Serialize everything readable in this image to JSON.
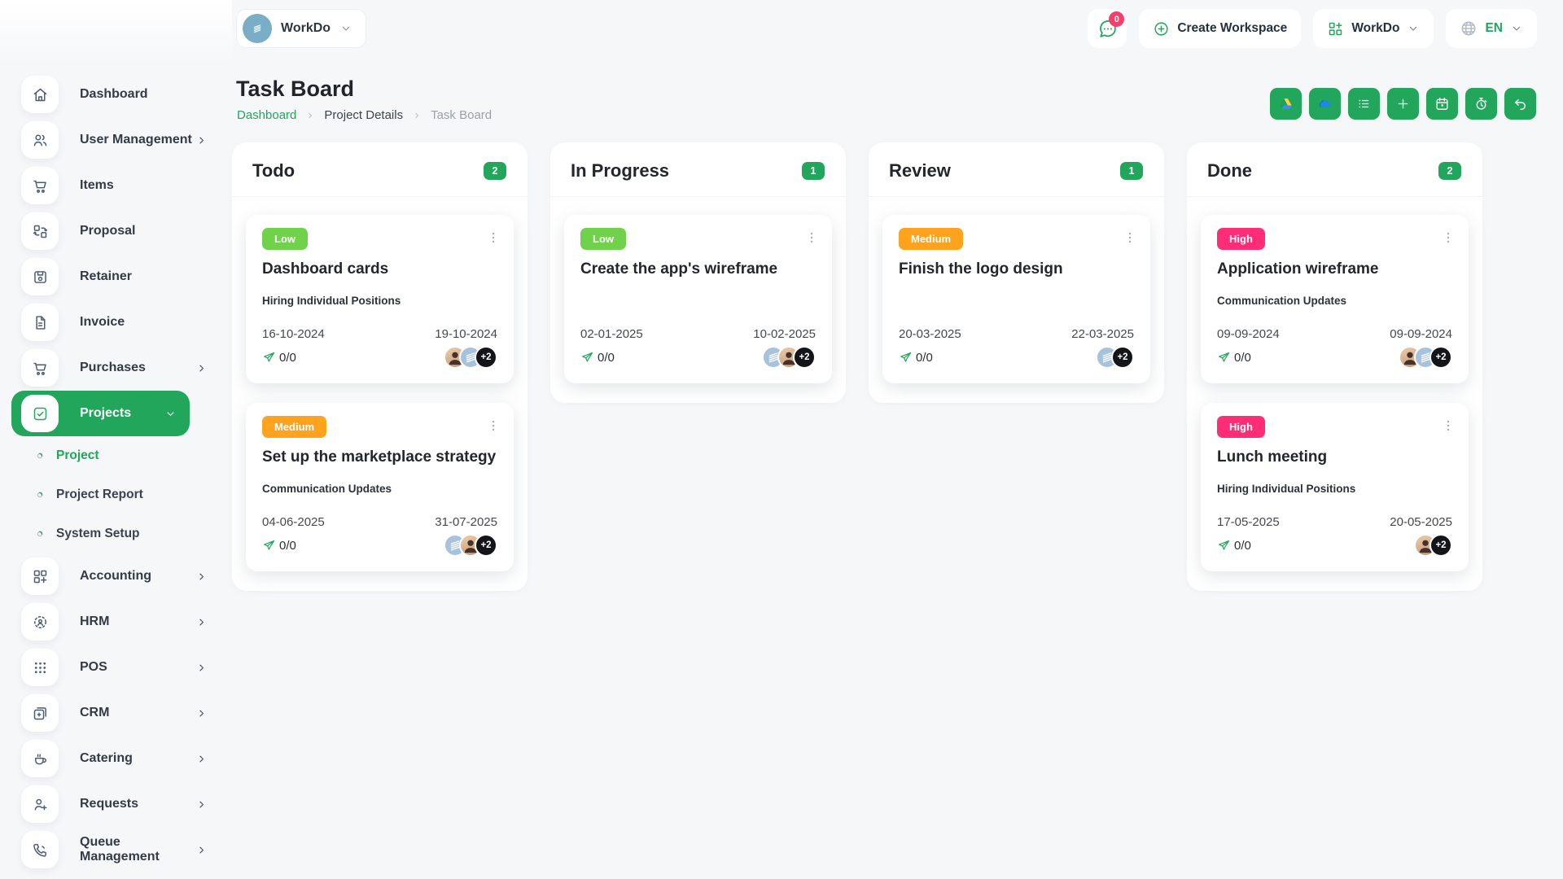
{
  "colors": {
    "primary": "#21a65b",
    "low": "#70d24b",
    "medium": "#ffa21d",
    "high": "#ff2d76",
    "notification": "#f73d6a"
  },
  "topbar": {
    "workspace": {
      "label": "WorkDo",
      "icon": "building-icon"
    },
    "messages": {
      "badge": "0",
      "icon": "chat-icon"
    },
    "create_workspace": {
      "label": "Create Workspace",
      "icon": "plus-circle-icon"
    },
    "app_switcher": {
      "label": "WorkDo",
      "icon": "grid-plus-icon"
    },
    "language": {
      "label": "EN",
      "icon": "globe-icon"
    }
  },
  "page": {
    "title": "Task Board",
    "breadcrumb": [
      {
        "label": "Dashboard",
        "state": "link"
      },
      {
        "label": "Project Details",
        "state": "mid"
      },
      {
        "label": "Task Board",
        "state": "current"
      }
    ]
  },
  "toolbar": [
    {
      "name": "google-drive-button",
      "icon": "google-drive-icon"
    },
    {
      "name": "onedrive-button",
      "icon": "onedrive-icon"
    },
    {
      "name": "milestone-list-button",
      "icon": "list-icon"
    },
    {
      "name": "add-task-button",
      "icon": "plus-icon"
    },
    {
      "name": "calendar-button",
      "icon": "calendar-icon"
    },
    {
      "name": "timer-button",
      "icon": "stopwatch-icon"
    },
    {
      "name": "back-button",
      "icon": "undo-icon"
    }
  ],
  "sidebar": {
    "items": [
      {
        "label": "Dashboard",
        "icon": "home-icon"
      },
      {
        "label": "User Management",
        "icon": "users-icon",
        "chevron": true
      },
      {
        "label": "Items",
        "icon": "cart-icon"
      },
      {
        "label": "Proposal",
        "icon": "proposal-icon"
      },
      {
        "label": "Retainer",
        "icon": "retainer-icon"
      },
      {
        "label": "Invoice",
        "icon": "invoice-icon"
      },
      {
        "label": "Purchases",
        "icon": "cart-icon",
        "chevron": true
      },
      {
        "label": "Projects",
        "icon": "check-square-icon",
        "chevron": true,
        "active": true,
        "expanded": true
      },
      {
        "label": "Project",
        "sub": true,
        "active": true
      },
      {
        "label": "Project Report",
        "sub": true
      },
      {
        "label": "System Setup",
        "sub": true
      },
      {
        "label": "Accounting",
        "icon": "accounting-icon",
        "chevron": true
      },
      {
        "label": "HRM",
        "icon": "hrm-icon",
        "chevron": true
      },
      {
        "label": "POS",
        "icon": "pos-icon",
        "chevron": true
      },
      {
        "label": "CRM",
        "icon": "crm-icon",
        "chevron": true
      },
      {
        "label": "Catering",
        "icon": "catering-icon",
        "chevron": true
      },
      {
        "label": "Requests",
        "icon": "user-plus-icon",
        "chevron": true
      },
      {
        "label": "Queue Management",
        "icon": "phone-icon",
        "chevron": true
      }
    ]
  },
  "board": {
    "columns": [
      {
        "title": "Todo",
        "count": "2",
        "cards": [
          {
            "priority": "Low",
            "title": "Dashboard cards",
            "milestone": "Hiring Individual Positions",
            "start_date": "16-10-2024",
            "end_date": "19-10-2024",
            "progress": "0/0",
            "avatars": [
              "photo",
              "logo"
            ],
            "more": "+2"
          },
          {
            "priority": "Medium",
            "title": "Set up the marketplace strategy",
            "milestone": "Communication Updates",
            "start_date": "04-06-2025",
            "end_date": "31-07-2025",
            "progress": "0/0",
            "avatars": [
              "logo",
              "photo"
            ],
            "more": "+2"
          }
        ]
      },
      {
        "title": "In Progress",
        "count": "1",
        "cards": [
          {
            "priority": "Low",
            "title": "Create the app's wireframe",
            "milestone": "",
            "start_date": "02-01-2025",
            "end_date": "10-02-2025",
            "progress": "0/0",
            "avatars": [
              "logo",
              "photo"
            ],
            "more": "+2"
          }
        ]
      },
      {
        "title": "Review",
        "count": "1",
        "cards": [
          {
            "priority": "Medium",
            "title": "Finish the logo design",
            "milestone": "",
            "start_date": "20-03-2025",
            "end_date": "22-03-2025",
            "progress": "0/0",
            "avatars": [
              "logo"
            ],
            "more": "+2"
          }
        ]
      },
      {
        "title": "Done",
        "count": "2",
        "cards": [
          {
            "priority": "High",
            "title": "Application wireframe",
            "milestone": "Communication Updates",
            "start_date": "09-09-2024",
            "end_date": "09-09-2024",
            "progress": "0/0",
            "avatars": [
              "photo",
              "logo"
            ],
            "more": "+2"
          },
          {
            "priority": "High",
            "title": "Lunch meeting",
            "milestone": "Hiring Individual Positions",
            "start_date": "17-05-2025",
            "end_date": "20-05-2025",
            "progress": "0/0",
            "avatars": [
              "photo"
            ],
            "more": "+2"
          }
        ]
      }
    ]
  }
}
